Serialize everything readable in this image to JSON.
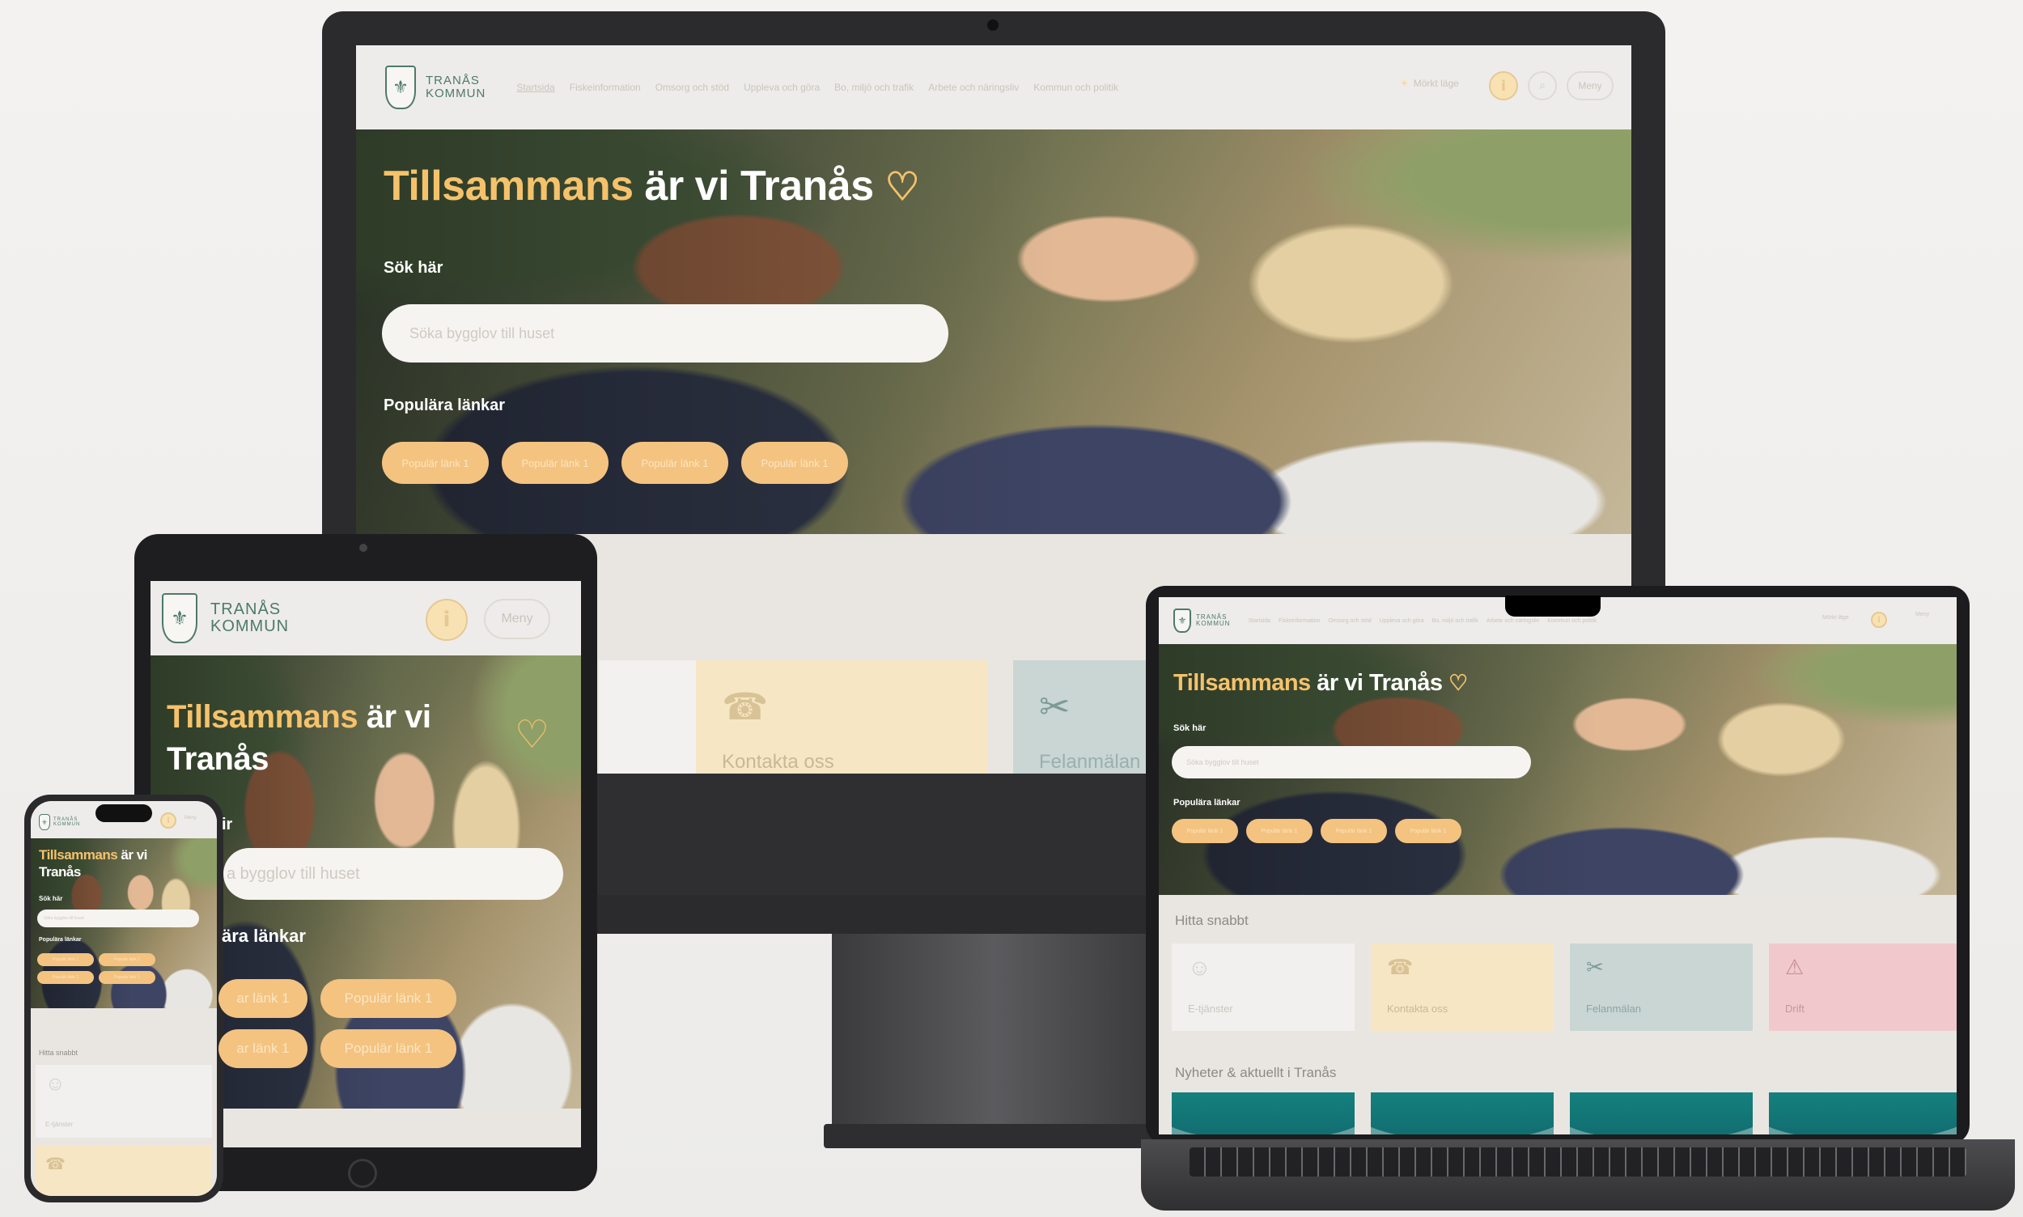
{
  "site": {
    "logo_line1": "TRANÅS",
    "logo_line2": "KOMMUN",
    "nav": [
      "Startsida",
      "Fiskeinformation",
      "Omsorg och stöd",
      "Uppleva och göra",
      "Bo, miljö och trafik",
      "Arbete och näringsliv",
      "Kommun och politik"
    ],
    "mobile_menu_label": "Mörkt läge",
    "menu_label": "Meny"
  },
  "hero": {
    "title_highlight": "Tillsammans",
    "title_rest": "är vi Tranås",
    "title_rest_tablet": "är vi",
    "title_line2_tablet": "Tranås",
    "title_rest_phone": "är vi",
    "title_line2_phone": "Tranås",
    "search_label": "Sök här",
    "search_placeholder": "Söka bygglov till huset",
    "tablet_search_fragment": "a bygglov till huset",
    "popular_label": "Populära länkar",
    "tablet_popular_fragment": "ära länkar",
    "popular_links": [
      "Populär länk 1",
      "Populär länk 1",
      "Populär länk 1",
      "Populär länk 1"
    ],
    "tablet_pill_fragment": "ar länk 1",
    "tablet_fragment_ir": "ir"
  },
  "quick": {
    "section_title": "Hitta snabbt",
    "cards": [
      {
        "label": "E-tjänster",
        "icon": "smiley-icon",
        "color": "#f1f0ee"
      },
      {
        "label": "Kontakta oss",
        "icon": "phone-icon",
        "color": "#f7e6c4"
      },
      {
        "label": "Felanmälan",
        "icon": "tools-icon",
        "color": "#c9d6d4"
      },
      {
        "label": "Drift",
        "icon": "warning-icon",
        "color": "#f1c9cc"
      }
    ],
    "monitor_partial_label": "Felanmälan"
  },
  "news": {
    "section_title": "Nyheter & aktuellt i Tranås"
  },
  "colors": {
    "accent": "#f5c26b",
    "brand_green": "#4d7a6a",
    "header_bg": "#eeecea"
  }
}
